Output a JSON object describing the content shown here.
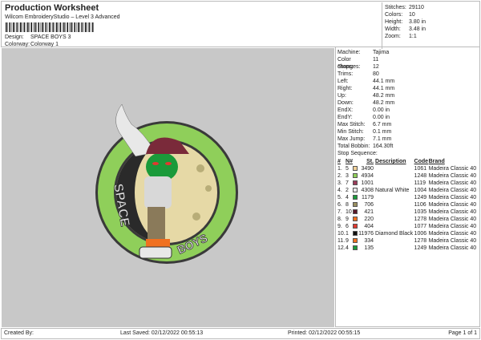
{
  "header": {
    "title": "Production Worksheet",
    "subtitle": "Wilcom EmbroideryStudio – Level 3 Advanced",
    "design_label": "Design:",
    "design": "SPACE BOYS 3",
    "colorway_label": "Colorway:",
    "colorway": "Colorway 1"
  },
  "stats": [
    {
      "k": "Stitches:",
      "v": "29110"
    },
    {
      "k": "Colors:",
      "v": "10"
    },
    {
      "k": "Height:",
      "v": "3.80 in"
    },
    {
      "k": "Width:",
      "v": "3.48 in"
    },
    {
      "k": "Zoom:",
      "v": "1:1"
    }
  ],
  "info": [
    {
      "k": "Machine:",
      "v": "Tajima"
    },
    {
      "k": "Color changes:",
      "v": "11"
    },
    {
      "k": "Stops:",
      "v": "12"
    },
    {
      "k": "Trims:",
      "v": "80"
    },
    {
      "k": "Left:",
      "v": "44.1 mm"
    },
    {
      "k": "Right:",
      "v": "44.1 mm"
    },
    {
      "k": "Up:",
      "v": "48.2 mm"
    },
    {
      "k": "Down:",
      "v": "48.2 mm"
    },
    {
      "k": "EndX:",
      "v": "0.00 in"
    },
    {
      "k": "EndY:",
      "v": "0.00 in"
    },
    {
      "k": "Max Stitch:",
      "v": "6.7 mm"
    },
    {
      "k": "Min Stitch:",
      "v": "0.1 mm"
    },
    {
      "k": "Max Jump:",
      "v": "7.1 mm"
    },
    {
      "k": "Total Bobbin:",
      "v": "164.30ft"
    }
  ],
  "stop_sequence": {
    "title": "Stop Sequence:",
    "columns": [
      "#",
      "N#",
      "",
      "St.",
      "Description",
      "Code",
      "Brand"
    ],
    "rows": [
      [
        "1.",
        "5",
        "#f2d29a",
        "3490",
        "",
        "1061",
        "Madeira Classic 40"
      ],
      [
        "2.",
        "3",
        "#8fcf5a",
        "4934",
        "",
        "1248",
        "Madeira Classic 40"
      ],
      [
        "3.",
        "7",
        "#9b3b5a",
        "1001",
        "",
        "1119",
        "Madeira Classic 40"
      ],
      [
        "4.",
        "2",
        "#e8e8ea",
        "4308",
        "Natural White",
        "1004",
        "Madeira Classic 40"
      ],
      [
        "5.",
        "4",
        "#1a9a3a",
        "1179",
        "",
        "1249",
        "Madeira Classic 40"
      ],
      [
        "6.",
        "8",
        "#9a9060",
        "706",
        "",
        "1106",
        "Madeira Classic 40"
      ],
      [
        "7.",
        "10",
        "#5a1a2a",
        "421",
        "",
        "1035",
        "Madeira Classic 40"
      ],
      [
        "8.",
        "9",
        "#f07020",
        "220",
        "",
        "1278",
        "Madeira Classic 40"
      ],
      [
        "9.",
        "6",
        "#e03a30",
        "404",
        "",
        "1077",
        "Madeira Classic 40"
      ],
      [
        "10.",
        "1",
        "#111111",
        "11976",
        "Diamond Black",
        "1006",
        "Madeira Classic 40"
      ],
      [
        "11.",
        "9",
        "#f07020",
        "334",
        "",
        "1278",
        "Madeira Classic 40"
      ],
      [
        "12.",
        "4",
        "#1a9a3a",
        "135",
        "",
        "1249",
        "Madeira Classic 40"
      ]
    ]
  },
  "design_art": {
    "left_text": "SPACE",
    "right_text": "BOYS"
  },
  "footer": {
    "created": "Created By:",
    "saved": "Last Saved: 02/12/2022 00:55:13",
    "printed": "Printed: 02/12/2022 00:55:15",
    "page": "Page 1 of 1"
  }
}
